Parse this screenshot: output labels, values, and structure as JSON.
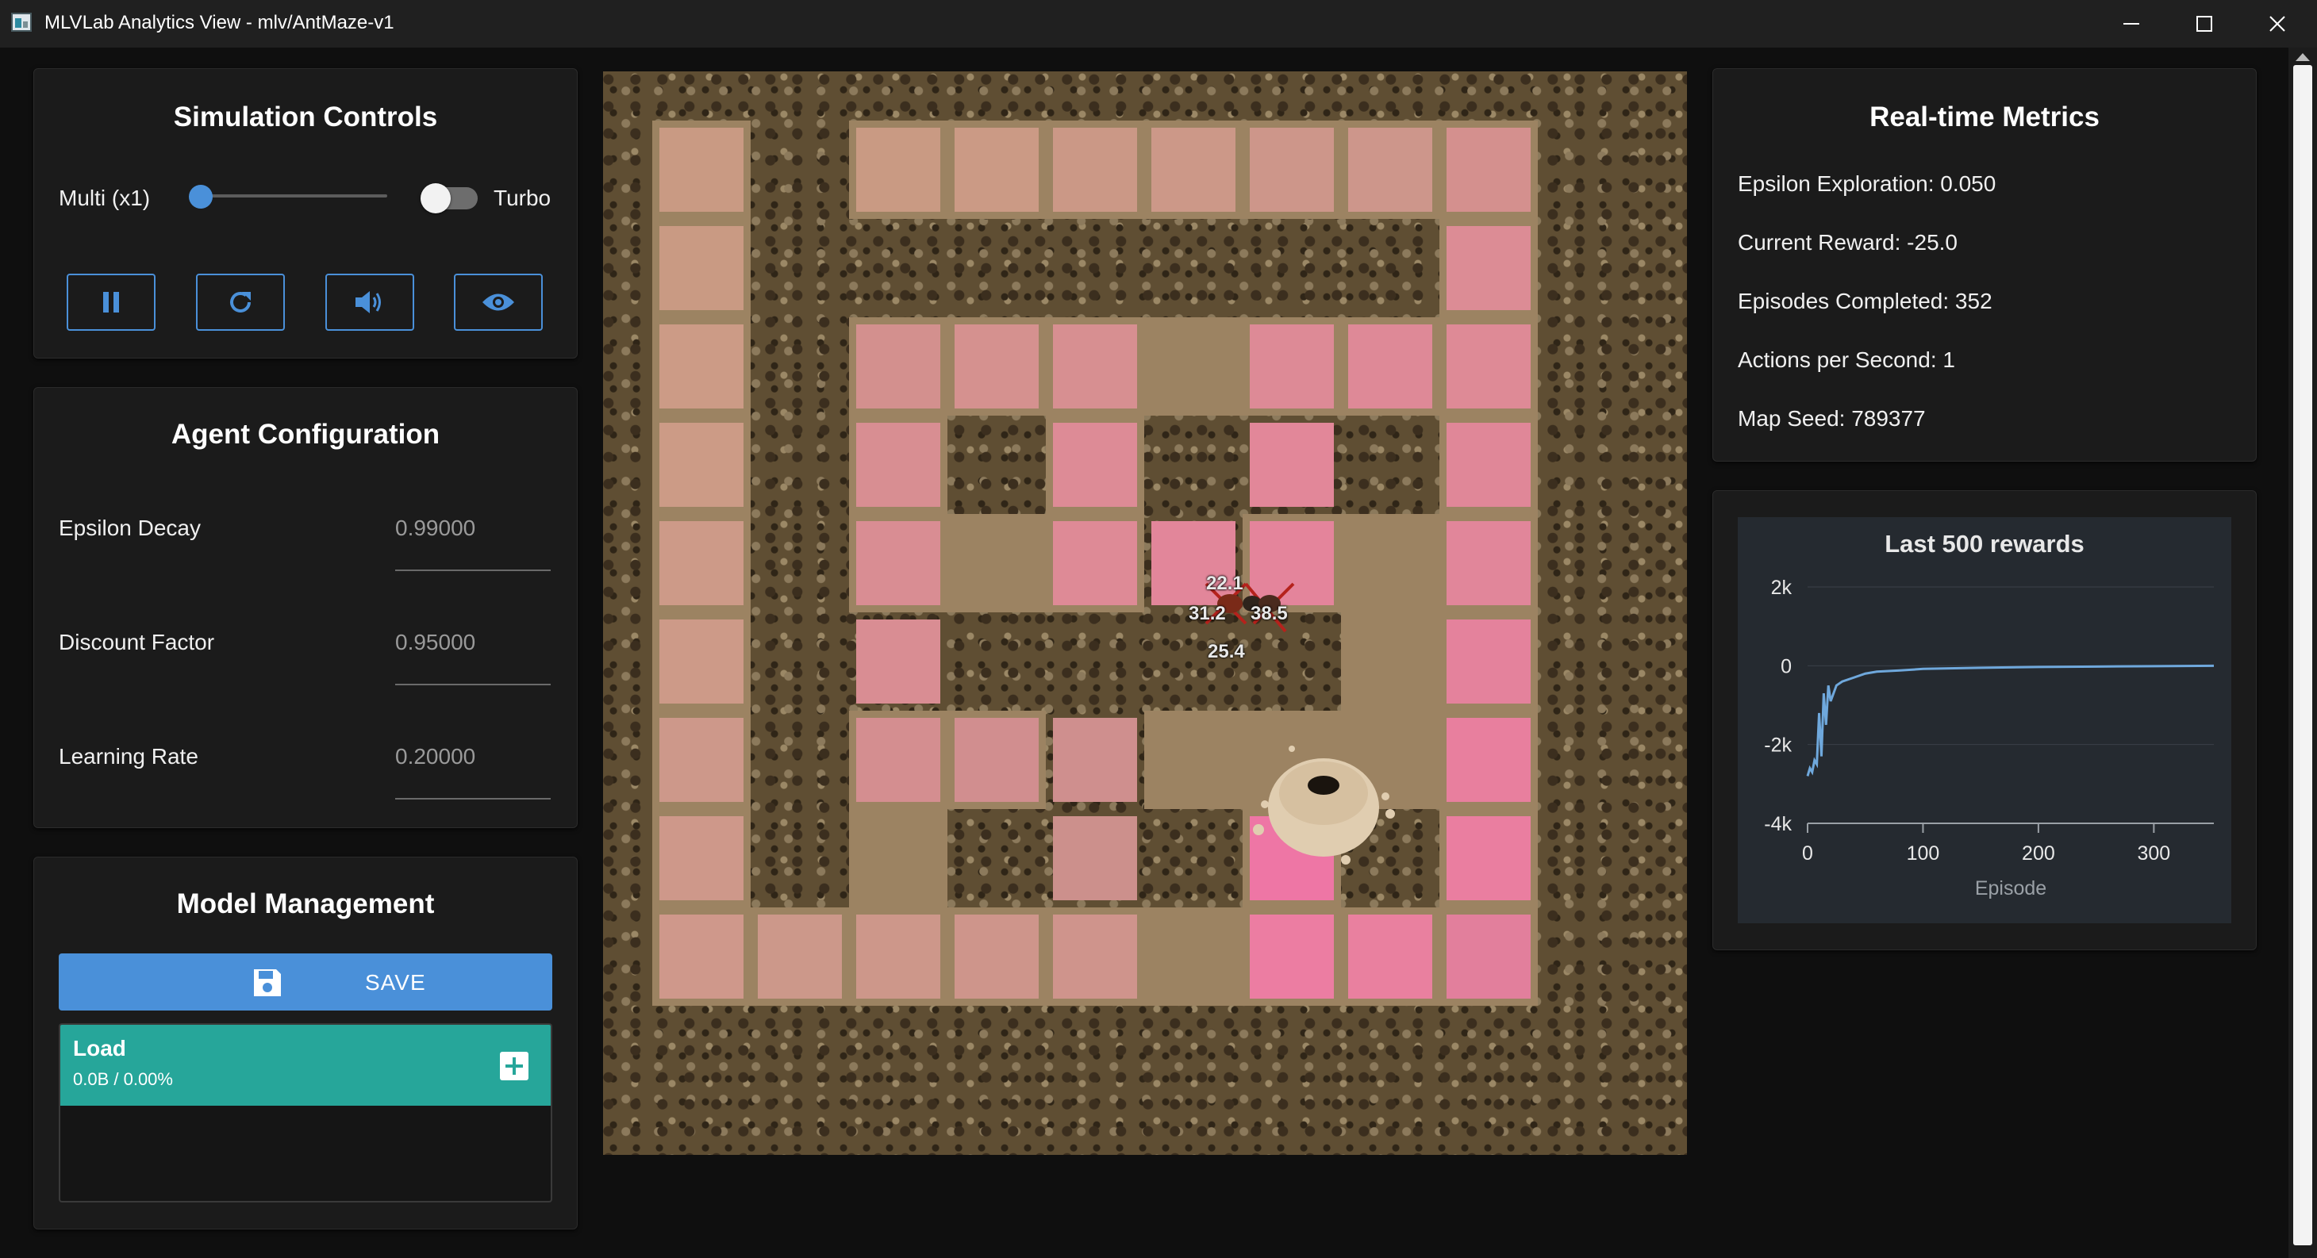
{
  "window": {
    "title": "MLVLab Analytics View - mlv/AntMaze-v1"
  },
  "sim_controls": {
    "title": "Simulation Controls",
    "speed_label": "Multi (x1)",
    "turbo_label": "Turbo",
    "speed_slider_value": 0,
    "turbo_on": false,
    "buttons": [
      "pause-icon",
      "restart-icon",
      "volume-icon",
      "eye-icon"
    ]
  },
  "agent_config": {
    "title": "Agent Configuration",
    "fields": [
      {
        "label": "Epsilon Decay",
        "value": "0.99000"
      },
      {
        "label": "Discount Factor",
        "value": "0.95000"
      },
      {
        "label": "Learning Rate",
        "value": "0.20000"
      }
    ]
  },
  "model_mgmt": {
    "title": "Model Management",
    "save_label": "SAVE",
    "load_title": "Load",
    "load_progress": "0.0B / 0.00%"
  },
  "maze": {
    "q_values": {
      "up": "22.1",
      "left": "31.2",
      "right": "38.5",
      "down": "25.4"
    }
  },
  "metrics": {
    "title": "Real-time Metrics",
    "lines": [
      "Epsilon Exploration: 0.050",
      "Current Reward: -25.0",
      "Episodes Completed: 352",
      "Actions per Second: 1",
      "Map Seed: 789377"
    ]
  },
  "chart_data": {
    "type": "line",
    "title": "Last 500 rewards",
    "xlabel": "Episode",
    "ylabel": "",
    "xlim": [
      0,
      352
    ],
    "ylim": [
      -4000,
      2000
    ],
    "x_ticks": [
      "0",
      "100",
      "200",
      "300"
    ],
    "y_ticks": [
      "2k",
      "0",
      "-2k",
      "-4k"
    ],
    "series": [
      {
        "color": "#6fa8dc",
        "x": [
          0,
          2,
          4,
          6,
          8,
          10,
          12,
          14,
          16,
          18,
          20,
          25,
          30,
          40,
          50,
          60,
          80,
          100,
          150,
          200,
          250,
          300,
          352
        ],
        "y": [
          -2800,
          -2600,
          -2700,
          -2400,
          -2500,
          -1200,
          -2300,
          -700,
          -1500,
          -500,
          -900,
          -500,
          -400,
          -300,
          -200,
          -150,
          -120,
          -80,
          -50,
          -30,
          -20,
          -10,
          0
        ]
      }
    ]
  }
}
